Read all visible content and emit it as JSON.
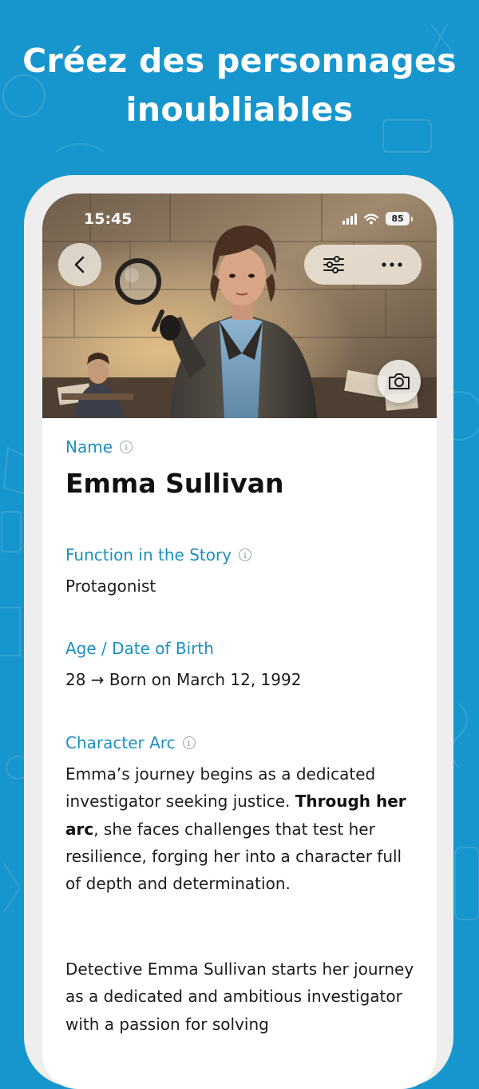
{
  "headline": {
    "line1": "Créez des personnages",
    "line2": "inoubliables"
  },
  "status_bar": {
    "time": "15:45",
    "battery": "85"
  },
  "hero": {
    "icons": {
      "back": "chevron-left-icon",
      "filters": "sliders-icon",
      "more": "ellipsis-icon",
      "camera": "camera-icon"
    }
  },
  "fields": {
    "name": {
      "label": "Name",
      "value": "Emma Sullivan"
    },
    "function": {
      "label": "Function in the Story",
      "value": "Protagonist"
    },
    "age": {
      "label": "Age / Date of Birth",
      "value": "28 → Born on March 12, 1992"
    },
    "arc": {
      "label": "Character Arc",
      "p1_start": "Emma’s journey begins as a dedicated investigator seeking justice.",
      "p1_bold": "Through her arc",
      "p1_end": ", she faces challenges that test her resilience, forging her into a character full of depth and determination.",
      "p2": "Detective Emma Sullivan starts her journey as a dedicated and ambitious investigator with a passion for solving"
    }
  },
  "colors": {
    "background": "#1796cd",
    "accent_label": "#1b8fc0"
  }
}
